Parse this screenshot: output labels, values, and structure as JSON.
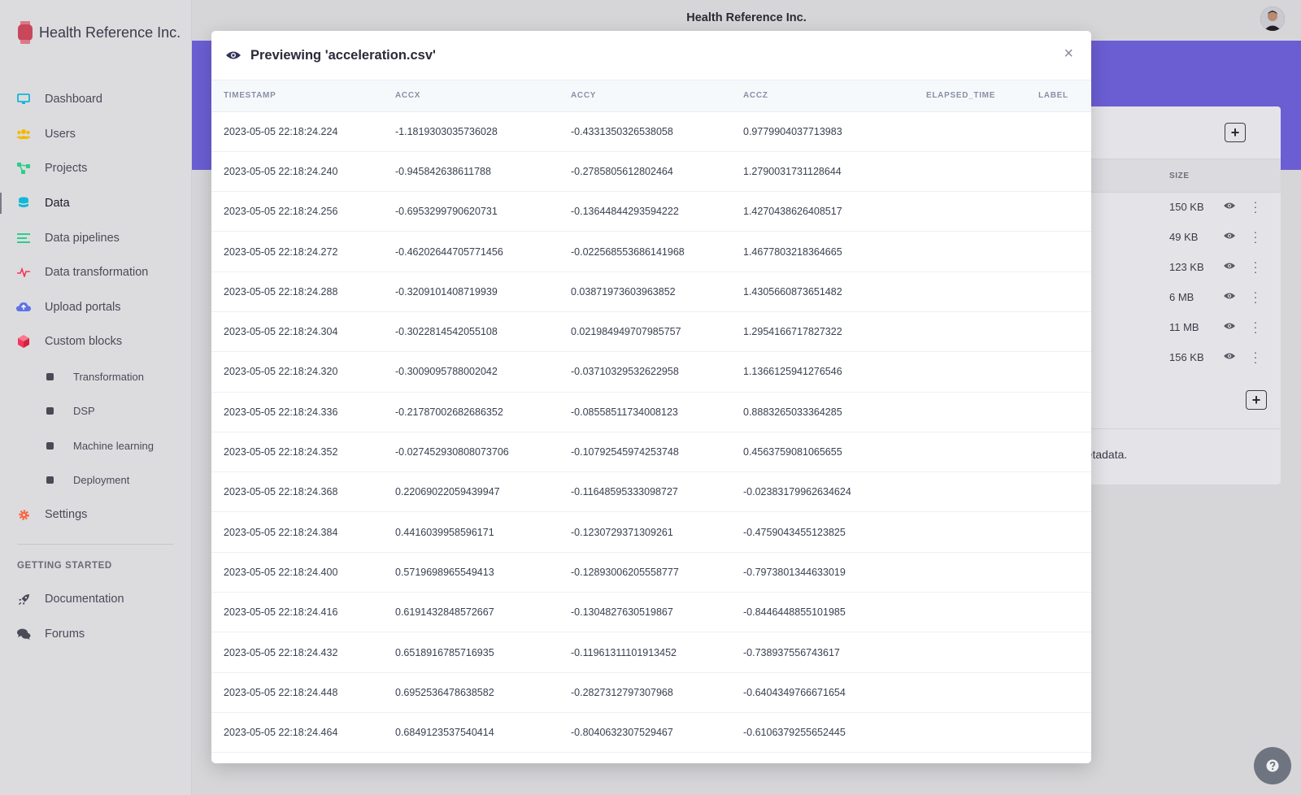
{
  "app": {
    "org_name": "Health Reference Inc.",
    "topbar_title": "Health Reference Inc."
  },
  "nav": [
    {
      "label": "Dashboard",
      "icon": "monitor-icon",
      "color": "#11b6d8"
    },
    {
      "label": "Users",
      "icon": "users-icon",
      "color": "#f5b800"
    },
    {
      "label": "Projects",
      "icon": "branch-icon",
      "color": "#2dce89"
    },
    {
      "label": "Data",
      "icon": "database-icon",
      "color": "#11b6d8"
    },
    {
      "label": "Data pipelines",
      "icon": "list-icon",
      "color": "#2dce89"
    },
    {
      "label": "Data transformation",
      "icon": "pulse-icon",
      "color": "#f5365c"
    },
    {
      "label": "Upload portals",
      "icon": "cloud-upload-icon",
      "color": "#5e72e4"
    },
    {
      "label": "Custom blocks",
      "icon": "cube-icon",
      "color": "#f5365c"
    }
  ],
  "sub_nav": [
    {
      "label": "Transformation"
    },
    {
      "label": "DSP"
    },
    {
      "label": "Machine learning"
    },
    {
      "label": "Deployment"
    }
  ],
  "settings": {
    "label": "Settings",
    "icon": "gear-icon",
    "color": "#fb6340"
  },
  "getting_started": {
    "heading": "GETTING STARTED",
    "items": [
      {
        "label": "Documentation",
        "icon": "rocket-icon"
      },
      {
        "label": "Forums",
        "icon": "comments-icon"
      }
    ]
  },
  "background_card": {
    "size_header": "SIZE",
    "sizes": [
      "150 KB",
      "49 KB",
      "123 KB",
      "6 MB",
      "11 MB",
      "156 KB"
    ],
    "metadata_text": "metadata."
  },
  "modal": {
    "title": "Previewing 'acceleration.csv'",
    "close_label": "×",
    "columns": [
      "TIMESTAMP",
      "ACCX",
      "ACCY",
      "ACCZ",
      "ELAPSED_TIME",
      "LABEL"
    ],
    "rows": [
      [
        "2023-05-05 22:18:24.224",
        "-1.1819303035736028",
        "-0.4331350326538058",
        "0.9779904037713983",
        "",
        ""
      ],
      [
        "2023-05-05 22:18:24.240",
        "-0.945842638611788",
        "-0.2785805612802464",
        "1.2790031731128644",
        "",
        ""
      ],
      [
        "2023-05-05 22:18:24.256",
        "-0.6953299790620731",
        "-0.13644844293594222",
        "1.4270438626408517",
        "",
        ""
      ],
      [
        "2023-05-05 22:18:24.272",
        "-0.46202644705771456",
        "-0.022568553686141968",
        "1.4677803218364665",
        "",
        ""
      ],
      [
        "2023-05-05 22:18:24.288",
        "-0.3209101408719939",
        "0.03871973603963852",
        "1.4305660873651482",
        "",
        ""
      ],
      [
        "2023-05-05 22:18:24.304",
        "-0.3022814542055108",
        "0.021984949707985757",
        "1.2954166717827322",
        "",
        ""
      ],
      [
        "2023-05-05 22:18:24.320",
        "-0.3009095788002042",
        "-0.03710329532622958",
        "1.1366125941276546",
        "",
        ""
      ],
      [
        "2023-05-05 22:18:24.336",
        "-0.21787002682686352",
        "-0.08558511734008123",
        "0.8883265033364285",
        "",
        ""
      ],
      [
        "2023-05-05 22:18:24.352",
        "-0.027452930808073706",
        "-0.10792545974253748",
        "0.4563759081065655",
        "",
        ""
      ],
      [
        "2023-05-05 22:18:24.368",
        "0.22069022059439947",
        "-0.11648595333098727",
        "-0.02383179962634624",
        "",
        ""
      ],
      [
        "2023-05-05 22:18:24.384",
        "0.4416039958596171",
        "-0.1230729371309261",
        "-0.4759043455123825",
        "",
        ""
      ],
      [
        "2023-05-05 22:18:24.400",
        "0.5719698965549413",
        "-0.12893006205558777",
        "-0.7973801344633019",
        "",
        ""
      ],
      [
        "2023-05-05 22:18:24.416",
        "0.6191432848572667",
        "-0.1304827630519867",
        "-0.8446448855101985",
        "",
        ""
      ],
      [
        "2023-05-05 22:18:24.432",
        "0.6518916785716935",
        "-0.11961311101913452",
        "-0.738937556743617",
        "",
        ""
      ],
      [
        "2023-05-05 22:18:24.448",
        "0.6952536478638582",
        "-0.2827312797307968",
        "-0.6404349766671654",
        "",
        ""
      ],
      [
        "2023-05-05 22:18:24.464",
        "0.6849123537540414",
        "-0.8040632307529467",
        "-0.6106379255652445",
        "",
        ""
      ]
    ]
  }
}
